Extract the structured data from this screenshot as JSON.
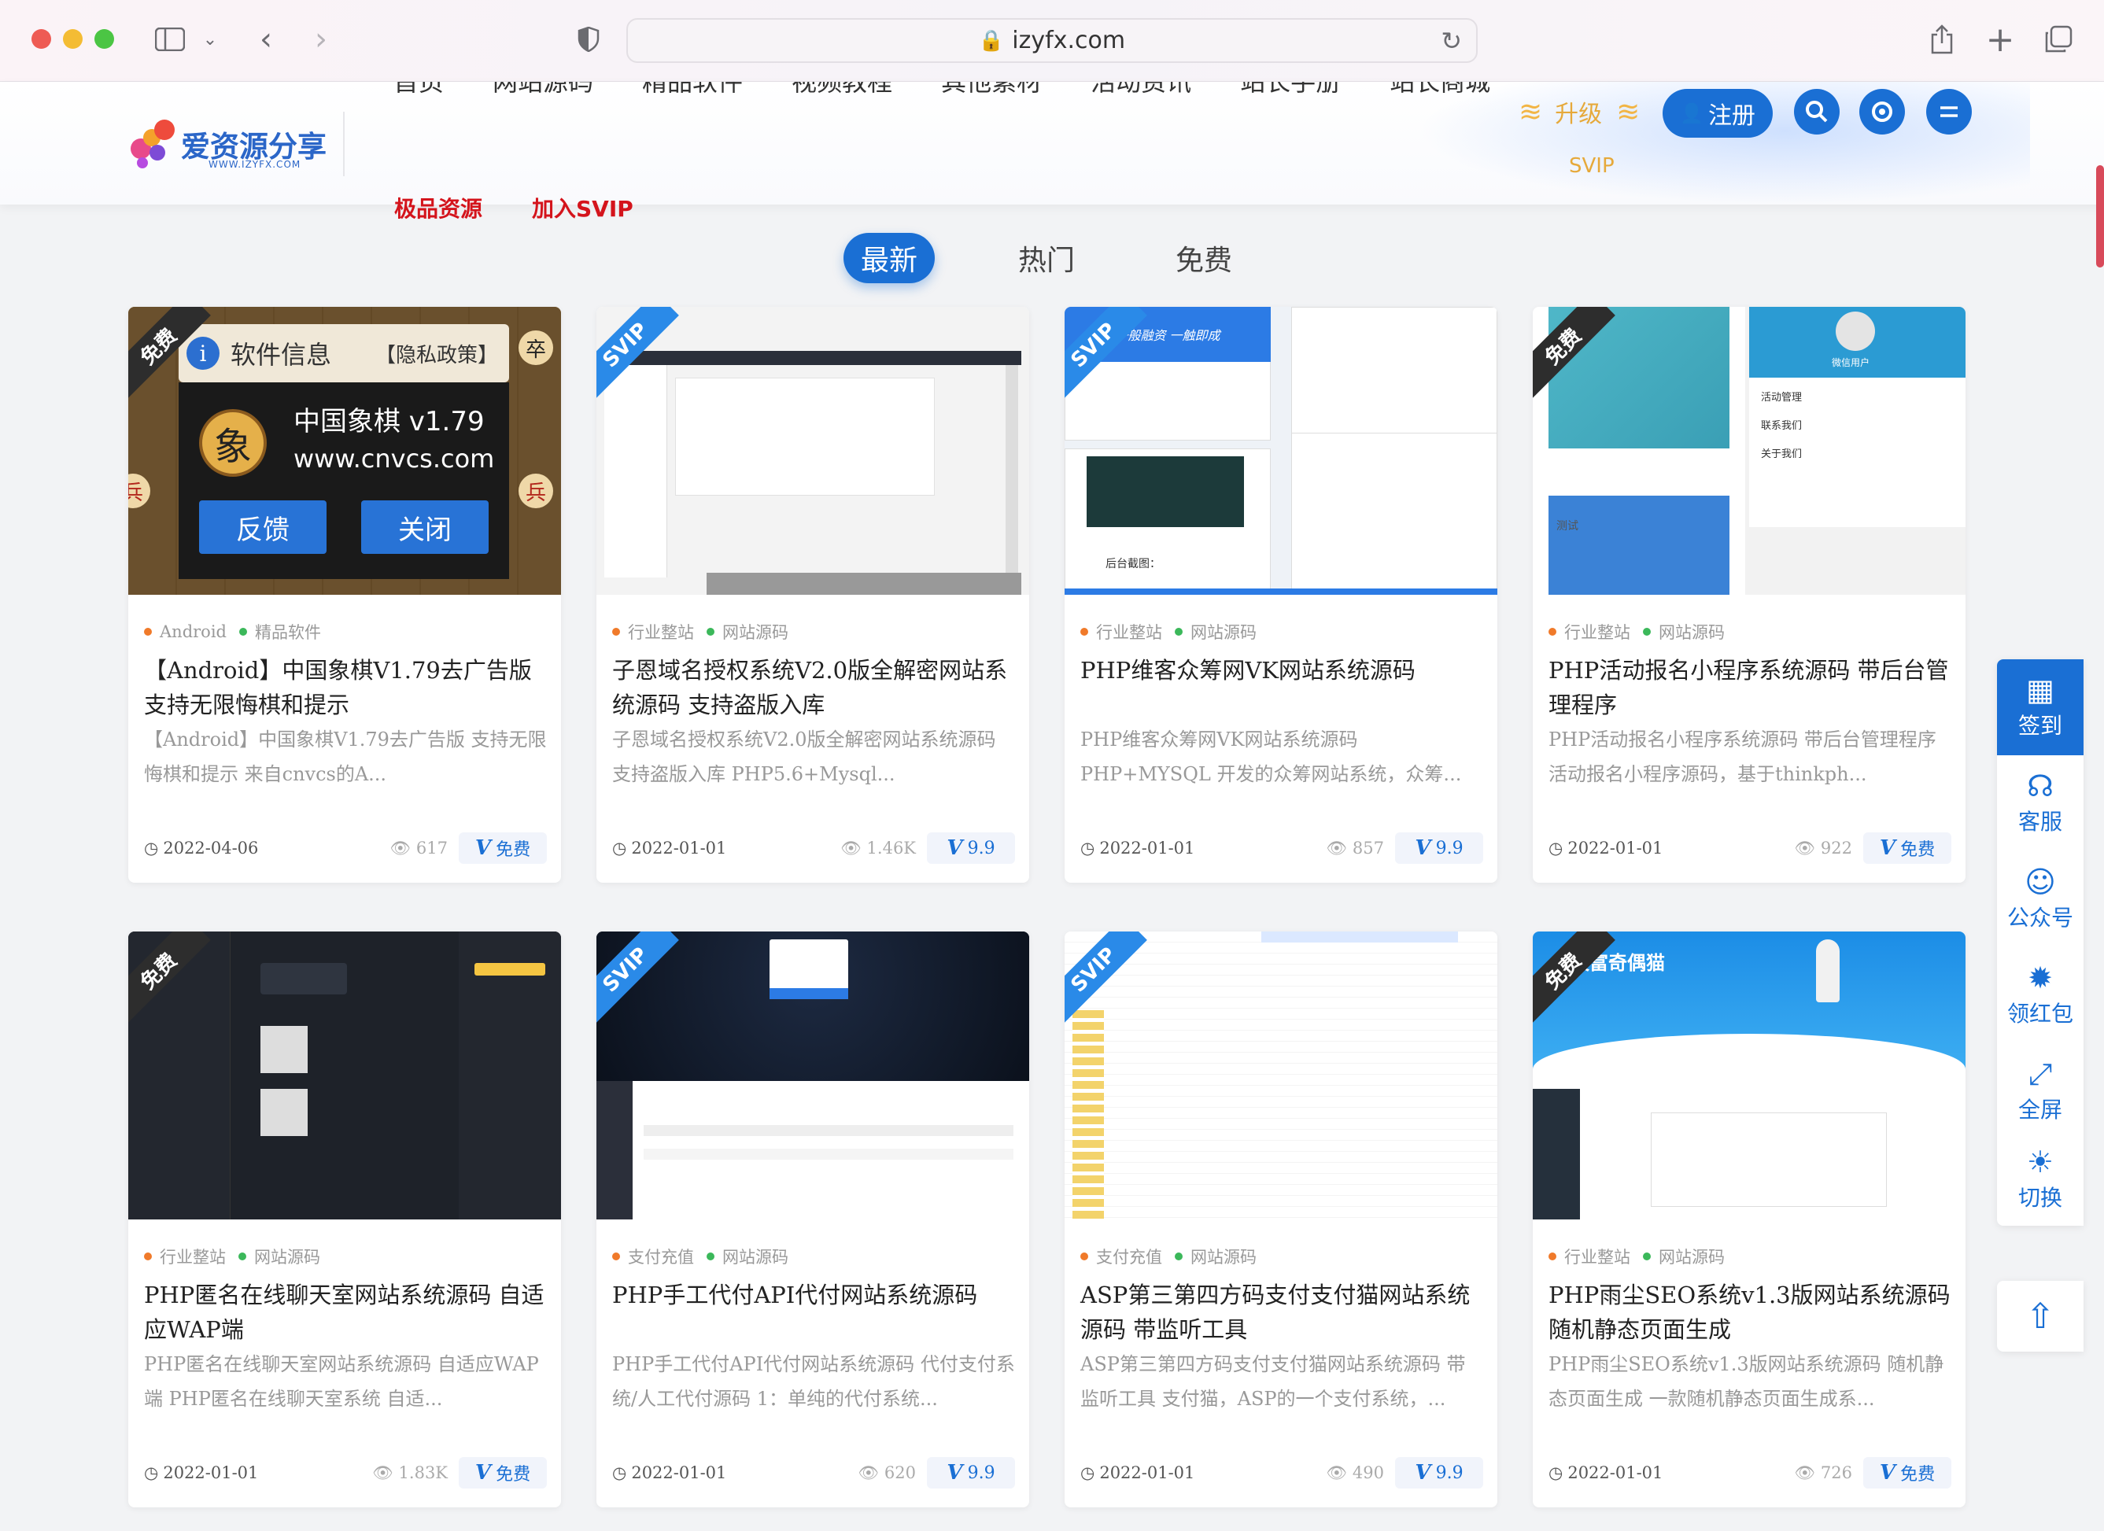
{
  "browser": {
    "url": "izyfx.com"
  },
  "site": {
    "logo_text": "爱资源分享",
    "logo_sub": "WWW.IZYFX.COM",
    "nav_top": [
      "首页",
      "网站源码",
      "精品软件",
      "视频教程",
      "其他素材",
      "活动资讯",
      "站长手册",
      "站长商城"
    ],
    "nav_extra": [
      "极品资源",
      "加入SVIP"
    ],
    "upgrade_label": "升级",
    "svip_label": "SVIP",
    "register_label": "注册"
  },
  "tabs": [
    "最新",
    "热门",
    "免费"
  ],
  "cards": [
    {
      "ribbon": "免费",
      "cat1": "Android",
      "cat2": "精品软件",
      "title": "【Android】中国象棋V1.79去广告版 支持无限悔棋和提示",
      "desc": "【Android】中国象棋V1.79去广告版 支持无限悔棋和提示 来自cnvcs的A...",
      "date": "2022-04-06",
      "views": "617",
      "price": "免费",
      "thumb": {
        "info": "软件信息",
        "policy": "【隐私政策】",
        "app": "中国象棋 v1.79",
        "site": "www.cnvcs.com",
        "btn1": "反馈",
        "btn2": "关闭",
        "piece": "象",
        "side1": "兵",
        "side2": "卒"
      }
    },
    {
      "ribbon": "SVIP",
      "cat1": "行业整站",
      "cat2": "网站源码",
      "title": "子恩域名授权系统V2.0版全解密网站系统源码 支持盗版入库",
      "desc": "子恩域名授权系统V2.0版全解密网站系统源码 支持盗版入库 PHP5.6+Mysql...",
      "date": "2022-01-01",
      "views": "1.46K",
      "price": "9.9"
    },
    {
      "ribbon": "SVIP",
      "cat1": "行业整站",
      "cat2": "网站源码",
      "title": "PHP维客众筹网VK网站系统源码",
      "desc": "PHP维客众筹网VK网站系统源码 PHP+MYSQL 开发的众筹网站系统，众筹...",
      "date": "2022-01-01",
      "views": "857",
      "price": "9.9",
      "thumb": {
        "banner": "一般融资 一触即成",
        "caption": "后台截图："
      }
    },
    {
      "ribbon": "免费",
      "cat1": "行业整站",
      "cat2": "网站源码",
      "title": "PHP活动报名小程序系统源码 带后台管理程序",
      "desc": "PHP活动报名小程序系统源码 带后台管理程序 活动报名小程序源码，基于thinkph...",
      "date": "2022-01-01",
      "views": "922",
      "price": "免费",
      "thumb": {
        "user": "微信用户",
        "menu1": "活动管理",
        "menu2": "联系我们",
        "menu3": "关于我们",
        "test": "测试"
      }
    },
    {
      "ribbon": "免费",
      "cat1": "行业整站",
      "cat2": "网站源码",
      "title": "PHP匿名在线聊天室网站系统源码 自适应WAP端",
      "desc": "PHP匿名在线聊天室网站系统源码 自适应WAP端 PHP匿名在线聊天室系统 自适...",
      "date": "2022-01-01",
      "views": "1.83K",
      "price": "免费"
    },
    {
      "ribbon": "SVIP",
      "cat1": "支付充值",
      "cat2": "网站源码",
      "title": "PHP手工代付API代付网站系统源码",
      "desc": "PHP手工代付API代付网站系统源码 代付支付系统/人工代付源码 1：单纯的代付系统...",
      "date": "2022-01-01",
      "views": "620",
      "price": "9.9"
    },
    {
      "ribbon": "SVIP",
      "cat1": "支付充值",
      "cat2": "网站源码",
      "title": "ASP第三第四方码支付支付猫网站系统源码 带监听工具",
      "desc": "ASP第三第四方码支付支付猫网站系统源码 带监听工具 支付猫，ASP的一个支付系统，...",
      "date": "2022-01-01",
      "views": "490",
      "price": "9.9"
    },
    {
      "ribbon": "免费",
      "cat1": "行业整站",
      "cat2": "网站源码",
      "title": "PHP雨尘SEO系统v1.3版网站系统源码 随机静态页面生成",
      "desc": "PHP雨尘SEO系统v1.3版网站系统源码 随机静态页面生成 一款随机静态页面生成系...",
      "date": "2022-01-01",
      "views": "726",
      "price": "免费",
      "thumb": {
        "banner": "天富奇偶猫"
      }
    }
  ],
  "sidebar": [
    "签到",
    "客服",
    "公众号",
    "领红包",
    "全屏",
    "切换"
  ],
  "colors": {
    "brand_blue": "#1a6fd4",
    "svip_gold": "#e6a93a",
    "nav_red": "#d4141c",
    "dot_orange": "#f07a2a",
    "dot_green": "#3bb85a"
  }
}
